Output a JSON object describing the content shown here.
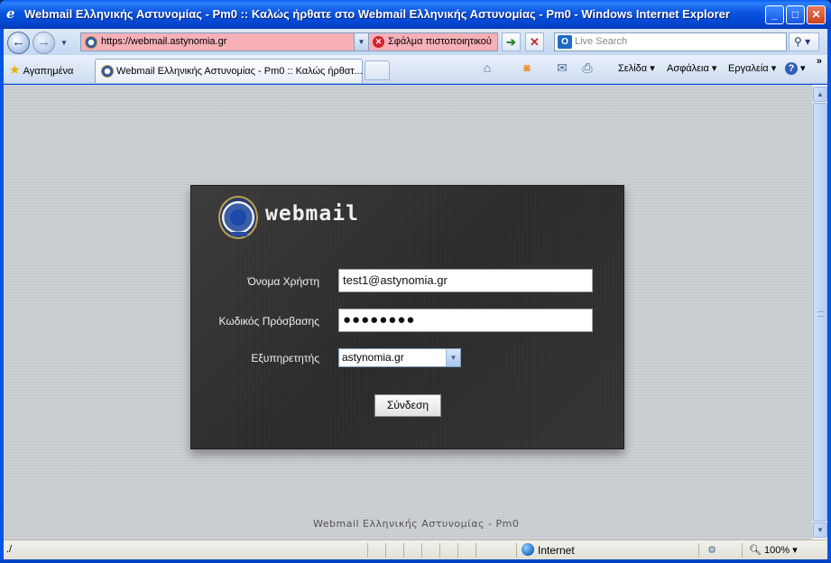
{
  "window": {
    "title": "Webmail Ελληνικής Αστυνομίας - Pm0 :: Καλώς ήρθατε στο Webmail Ελληνικής Αστυνομίας - Pm0 - Windows Internet Explorer",
    "minimize": "_",
    "maximize": "□",
    "close": "✕"
  },
  "address": {
    "url": "https://webmail.astynomia.gr",
    "cert_error": "Σφάλμα πιστοποιητικού",
    "search_placeholder": "Live Search"
  },
  "commandbar": {
    "favorites": "Αγαπημένα",
    "tab_title": "Webmail Ελληνικής Αστυνομίας - Pm0 :: Καλώς ήρθατ...",
    "page": "Σελίδα",
    "safety": "Ασφάλεια",
    "tools": "Εργαλεία",
    "help": "?"
  },
  "login": {
    "brand": "webmail",
    "username_label": "Όνομα Χρήστη",
    "username_value": "test1@astynomia.gr",
    "password_label": "Κωδικός Πρόσβασης",
    "password_mask": "●●●●●●●●",
    "server_label": "Εξυπηρετητής",
    "server_value": "astynomia.gr",
    "submit": "Σύνδεση"
  },
  "footer": "Webmail Ελληνικής Αστυνομίας - Pm0",
  "status": {
    "left": "./",
    "zone": "Internet",
    "zoom": "100%"
  }
}
